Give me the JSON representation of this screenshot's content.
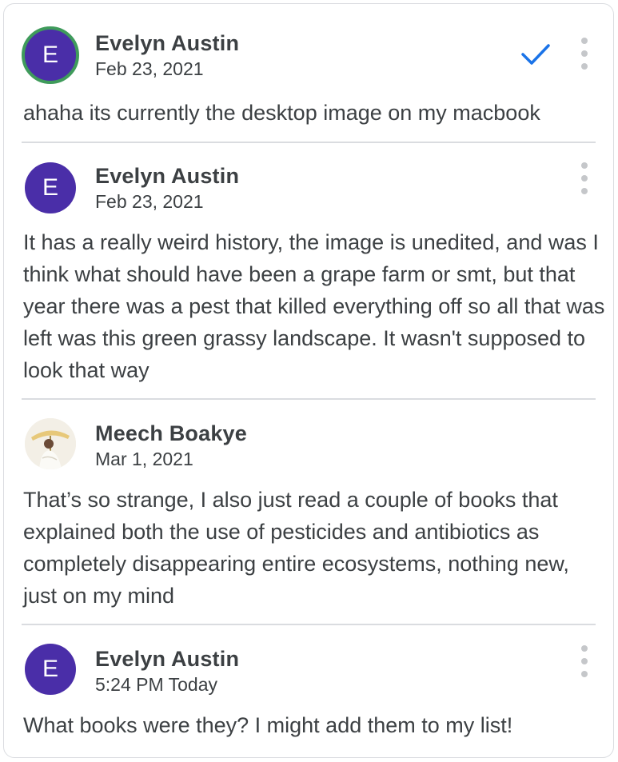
{
  "comments": [
    {
      "author": "Evelyn Austin",
      "avatar_letter": "E",
      "date": "Feb 23, 2021",
      "text": "ahaha its currently the desktop image on my macbook",
      "resolved_icon": "check-icon",
      "more_icon": "more-vert-icon"
    },
    {
      "author": "Evelyn Austin",
      "avatar_letter": "E",
      "date": "Feb 23, 2021",
      "text": "It has a really weird history, the image is unedited, and was I think what should have been a grape farm or smt, but that year there was a pest that killed everything off so all that was left was this green grassy landscape. It wasn't supposed to look that way",
      "more_icon": "more-vert-icon"
    },
    {
      "author": "Meech Boakye",
      "avatar_letter": "",
      "date": "Mar 1, 2021",
      "text": "That’s so strange, I also just read a couple of books that explained both the use of pesticides and antibiotics as completely disappearing entire ecosystems, nothing new, just on my mind",
      "more_icon": "more-vert-icon"
    },
    {
      "author": "Evelyn Austin",
      "avatar_letter": "E",
      "date": "5:24 PM Today",
      "text": "What books were they? I might add them to my list!",
      "more_icon": "more-vert-icon"
    }
  ],
  "colors": {
    "avatar_purple": "#4a2ea8",
    "active_ring": "#3f9b5b",
    "check_blue": "#1a73e8",
    "divider": "#dadce0",
    "text": "#3c4043"
  }
}
